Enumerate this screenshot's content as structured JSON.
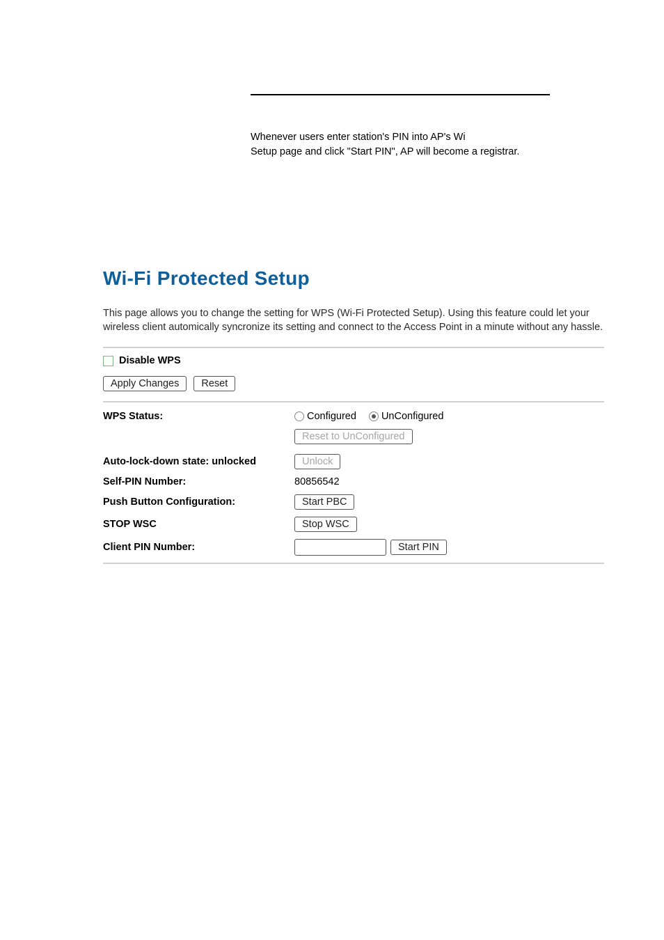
{
  "upper": {
    "line1": "Whenever users enter station's PIN into AP's Wi",
    "line2": "Setup page and click \"Start PIN\", AP will become a registrar."
  },
  "title": "Wi-Fi Protected Setup",
  "description": "This page allows you to change the setting for WPS (Wi-Fi Protected Setup). Using this feature could let your wireless client automically syncronize its setting and connect to the Access Point in a minute without any hassle.",
  "disable_wps_label": "Disable WPS",
  "disable_wps_checked": false,
  "buttons": {
    "apply_changes": "Apply Changes",
    "reset": "Reset",
    "reset_unconfigured": "Reset to UnConfigured",
    "unlock": "Unlock",
    "start_pbc": "Start PBC",
    "stop_wsc": "Stop WSC",
    "start_pin": "Start PIN"
  },
  "labels": {
    "wps_status": "WPS Status:",
    "auto_lock": "Auto-lock-down state: unlocked",
    "self_pin": "Self-PIN Number:",
    "pbc": "Push Button Configuration:",
    "stop_wsc": "STOP WSC",
    "client_pin": "Client PIN Number:"
  },
  "wps_status": {
    "configured_label": "Configured",
    "unconfigured_label": "UnConfigured",
    "selected": "UnConfigured"
  },
  "values": {
    "self_pin": "80856542",
    "client_pin": ""
  }
}
